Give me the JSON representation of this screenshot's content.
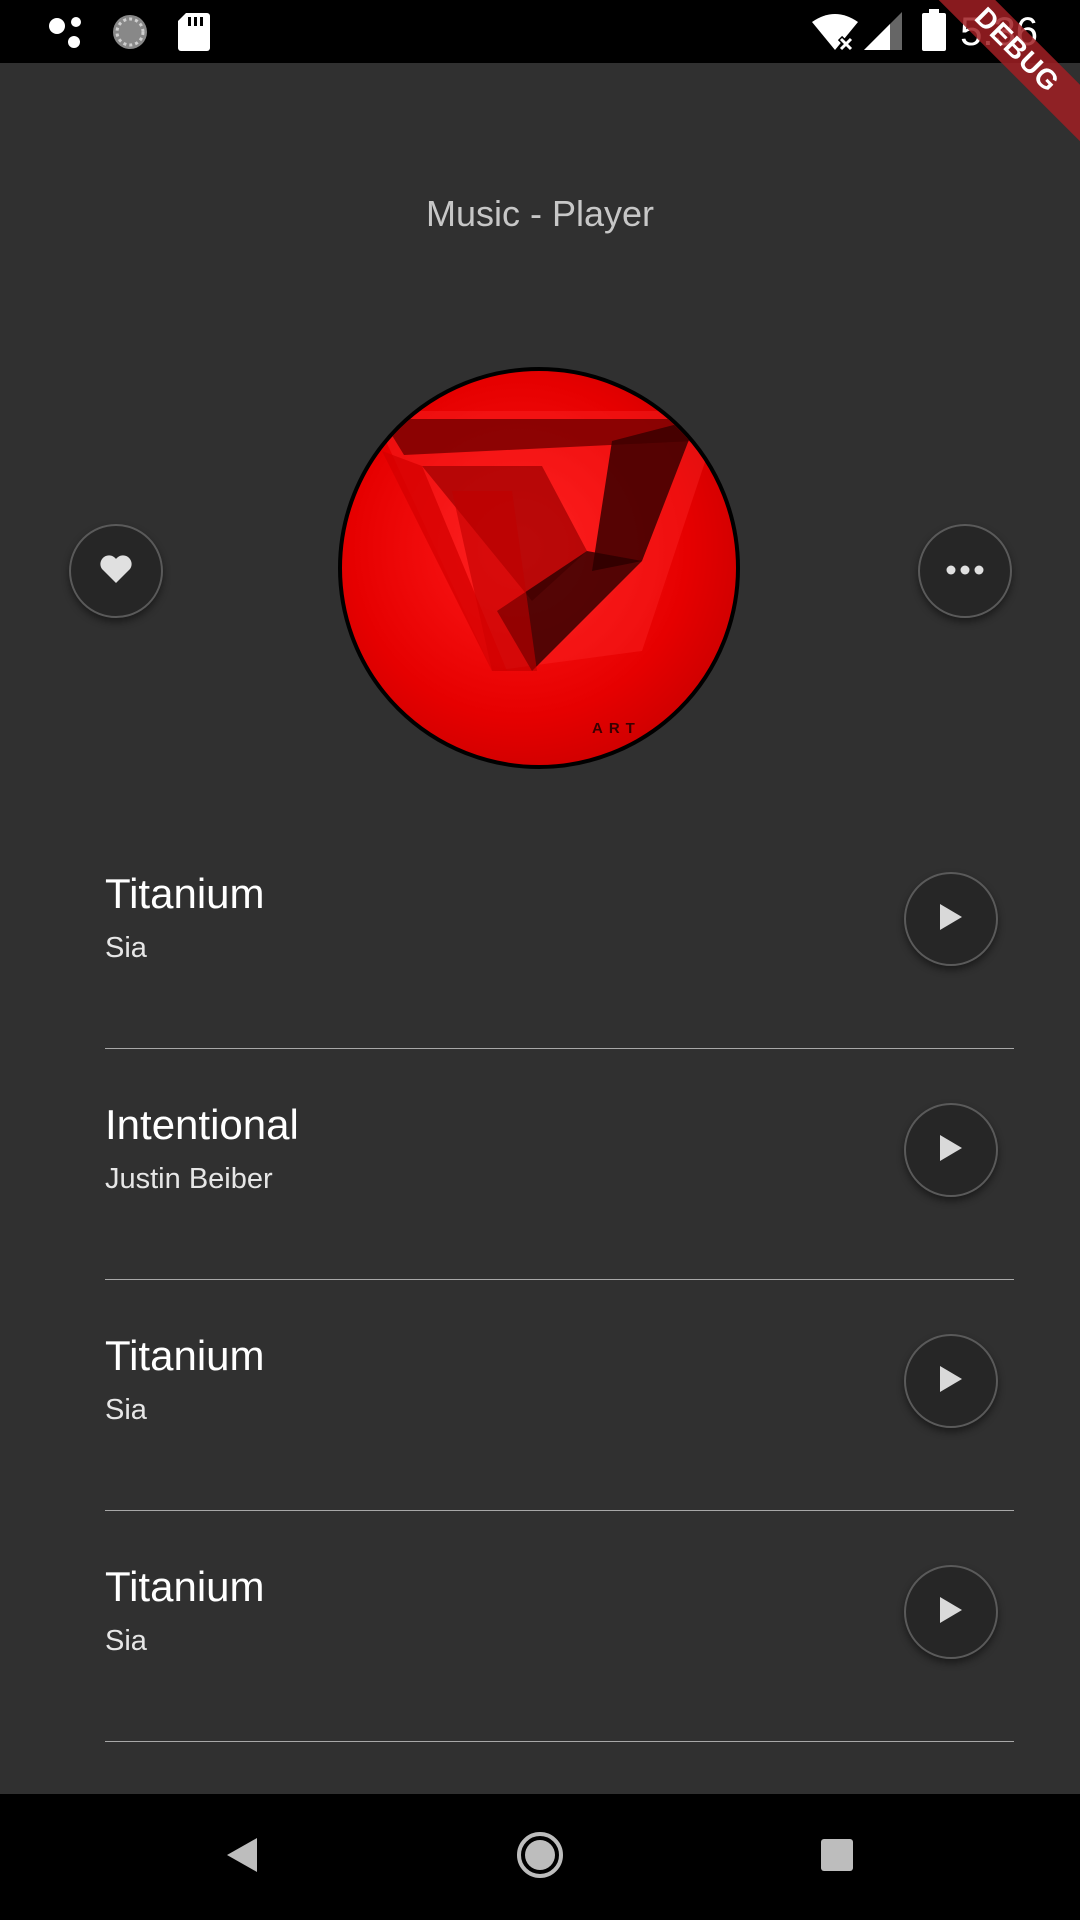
{
  "status_bar": {
    "time": "5:36",
    "icons": [
      "assistant-dots-icon",
      "sync-spinner-icon",
      "sd-card-icon",
      "wifi-off-icon",
      "cell-signal-icon",
      "battery-icon"
    ]
  },
  "debug_banner": {
    "label": "DEBUG"
  },
  "header": {
    "title": "Music - Player"
  },
  "album": {
    "art_text": "ART",
    "favorite_icon": "heart-icon",
    "more_icon": "more-dots-icon"
  },
  "songs": [
    {
      "title": "Titanium",
      "artist": "Sia"
    },
    {
      "title": "Intentional",
      "artist": "Justin Beiber"
    },
    {
      "title": "Titanium",
      "artist": "Sia"
    },
    {
      "title": "Titanium",
      "artist": "Sia"
    }
  ],
  "colors": {
    "background": "#303030",
    "button_fill": "#262626",
    "accent_red": "#e60000"
  },
  "nav_bar": {
    "icons": [
      "back-triangle-icon",
      "home-circle-icon",
      "recents-square-icon"
    ]
  }
}
